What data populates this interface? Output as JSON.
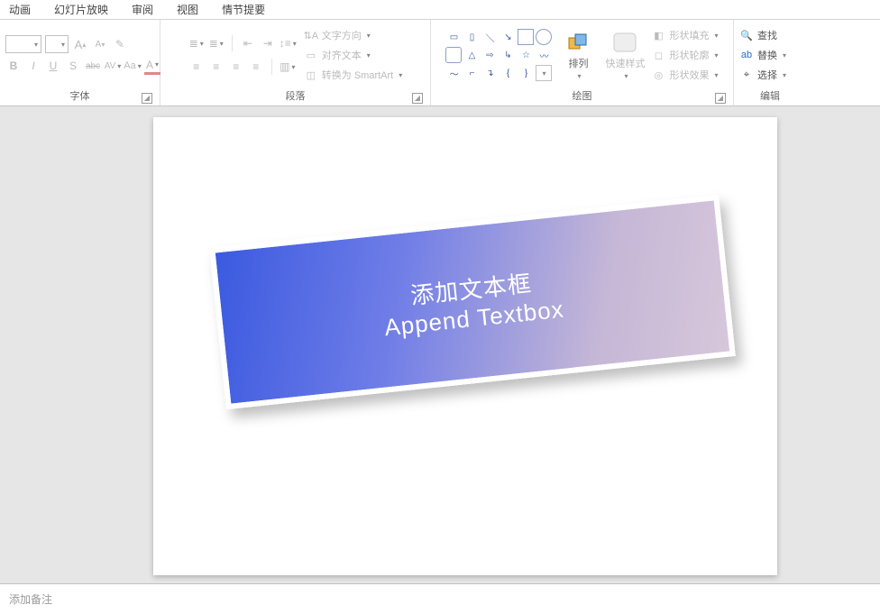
{
  "menu": {
    "items": [
      "动画",
      "幻灯片放映",
      "审阅",
      "视图",
      "情节提要"
    ]
  },
  "groups": {
    "font": {
      "label": "字体",
      "buttons": {
        "incFont": "A",
        "decFont": "A",
        "clear": "✎",
        "bold": "B",
        "italic": "I",
        "underline": "U",
        "strike": "S",
        "abc": "abc",
        "av": "AV",
        "aa": "Aa",
        "fontColor": "A"
      }
    },
    "paragraph": {
      "label": "段落",
      "lines": {
        "textDir": "文字方向",
        "align": "对齐文本",
        "smartart": "转换为 SmartArt"
      }
    },
    "drawing": {
      "label": "绘图",
      "arrange": "排列",
      "quickStyle": "快速样式",
      "shapeFill": "形状填充",
      "shapeOutline": "形状轮廓",
      "shapeEffects": "形状效果"
    },
    "editing": {
      "label": "编辑",
      "find": "查找",
      "replace": "替换",
      "select": "选择"
    }
  },
  "slide": {
    "textbox": {
      "line1": "添加文本框",
      "line2": "Append Textbox"
    }
  },
  "notes": {
    "placeholder": "添加备注"
  }
}
